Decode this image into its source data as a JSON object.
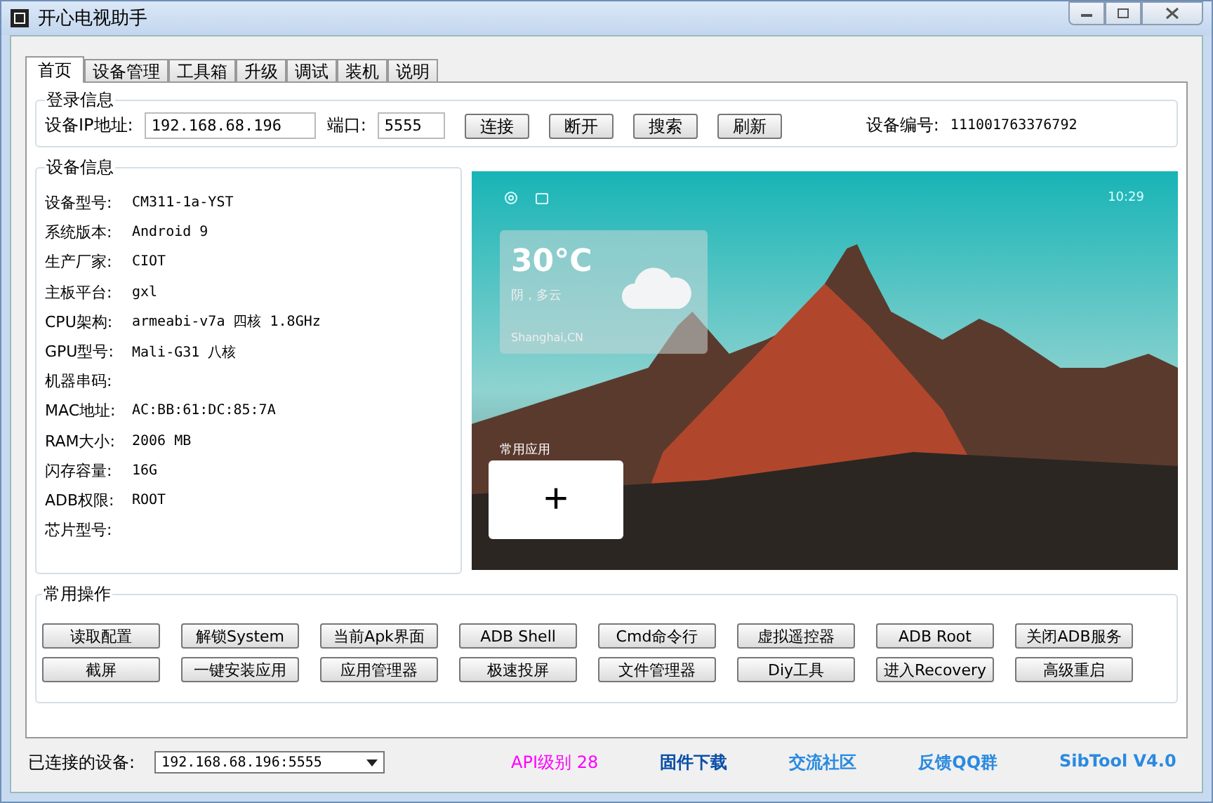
{
  "window": {
    "title": "开心电视助手"
  },
  "tabs": [
    {
      "label": "首页",
      "selected": true
    },
    {
      "label": "设备管理",
      "selected": false
    },
    {
      "label": "工具箱",
      "selected": false
    },
    {
      "label": "升级",
      "selected": false
    },
    {
      "label": "调试",
      "selected": false
    },
    {
      "label": "装机",
      "selected": false
    },
    {
      "label": "说明",
      "selected": false
    }
  ],
  "login": {
    "title": "登录信息",
    "ip_label": "设备IP地址:",
    "ip_value": "192.168.68.196",
    "port_label": "端口:",
    "port_value": "5555",
    "buttons": [
      "连接",
      "断开",
      "搜索",
      "刷新"
    ],
    "device_id_label": "设备编号:",
    "device_id": "111001763376792"
  },
  "device_info": {
    "title": "设备信息",
    "rows": [
      {
        "label": "设备型号:",
        "value": "CM311-1a-YST"
      },
      {
        "label": "系统版本:",
        "value": "Android 9"
      },
      {
        "label": "生产厂家:",
        "value": "CIOT"
      },
      {
        "label": "主板平台:",
        "value": "gxl"
      },
      {
        "label": "CPU架构:",
        "value": "armeabi-v7a 四核 1.8GHz"
      },
      {
        "label": "GPU型号:",
        "value": "Mali-G31 八核"
      },
      {
        "label": "机器串码:"
      },
      {
        "label": "MAC地址:",
        "value": "AC:BB:61:DC:85:7A"
      },
      {
        "label": "RAM大小:",
        "value": "2006 MB"
      },
      {
        "label": "闪存容量:",
        "value": "16G"
      },
      {
        "label": "ADB权限:",
        "value": "ROOT"
      },
      {
        "label": "芯片型号:"
      }
    ]
  },
  "preview": {
    "time": "10:29",
    "temperature": "30°C",
    "weather": "阴，多云",
    "location": "Shanghai,CN",
    "apps_label": "常用应用",
    "add_button": "+"
  },
  "operations": {
    "title": "常用操作",
    "buttons": [
      "读取配置",
      "解锁System",
      "当前Apk界面",
      "ADB Shell",
      "Cmd命令行",
      "虚拟遥控器",
      "ADB  Root",
      "关闭ADB服务",
      "截屏",
      "一键安装应用",
      "应用管理器",
      "极速投屏",
      "文件管理器",
      "Diy工具",
      "进入Recovery",
      "高级重启"
    ]
  },
  "status_bar": {
    "connected_label": "已连接的设备:",
    "device": "192.168.68.196:5555",
    "links": [
      {
        "text": "API级别 28",
        "color": "#ff00ff"
      },
      {
        "text": "固件下载",
        "color": "#0b4fa8"
      },
      {
        "text": "交流社区",
        "color": "#2a8ae0"
      },
      {
        "text": "反馈QQ群",
        "color": "#2a8ae0"
      },
      {
        "text": "SibTool V4.0",
        "color": "#2a8ae0"
      }
    ]
  }
}
